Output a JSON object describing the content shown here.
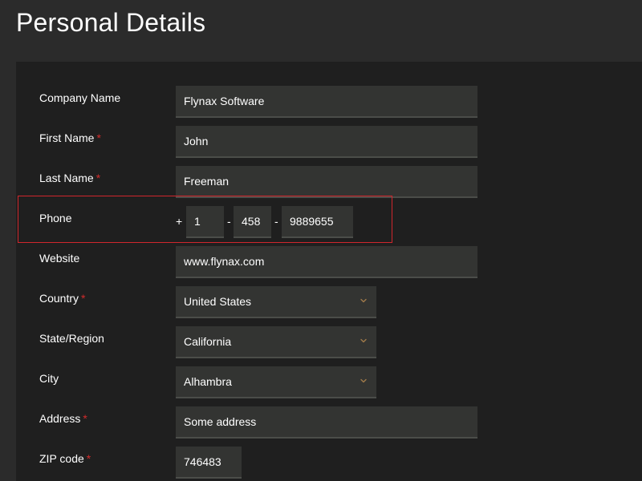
{
  "page": {
    "title": "Personal Details"
  },
  "form": {
    "company_name": {
      "label": "Company Name",
      "value": "Flynax Software"
    },
    "first_name": {
      "label": "First Name",
      "required_mark": "*",
      "value": "John"
    },
    "last_name": {
      "label": "Last Name",
      "required_mark": "*",
      "value": "Freeman"
    },
    "phone": {
      "label": "Phone",
      "plus": "+",
      "separator": "-",
      "country_code": "1",
      "area_code": "458",
      "number": "9889655"
    },
    "website": {
      "label": "Website",
      "value": "www.flynax.com"
    },
    "country": {
      "label": "Country",
      "required_mark": "*",
      "value": "United States",
      "icon": "chevron-down-icon"
    },
    "state": {
      "label": "State/Region",
      "value": "California",
      "icon": "chevron-down-icon"
    },
    "city": {
      "label": "City",
      "value": "Alhambra",
      "icon": "chevron-down-icon"
    },
    "address": {
      "label": "Address",
      "required_mark": "*",
      "value": "Some address"
    },
    "zip": {
      "label": "ZIP code",
      "required_mark": "*",
      "value": "746483"
    }
  },
  "colors": {
    "background": "#2b2b2b",
    "panel": "#1f1f1f",
    "field": "#333432",
    "required": "#d12b2b",
    "highlight": "#d0262c",
    "chevron": "#a07a4a"
  }
}
